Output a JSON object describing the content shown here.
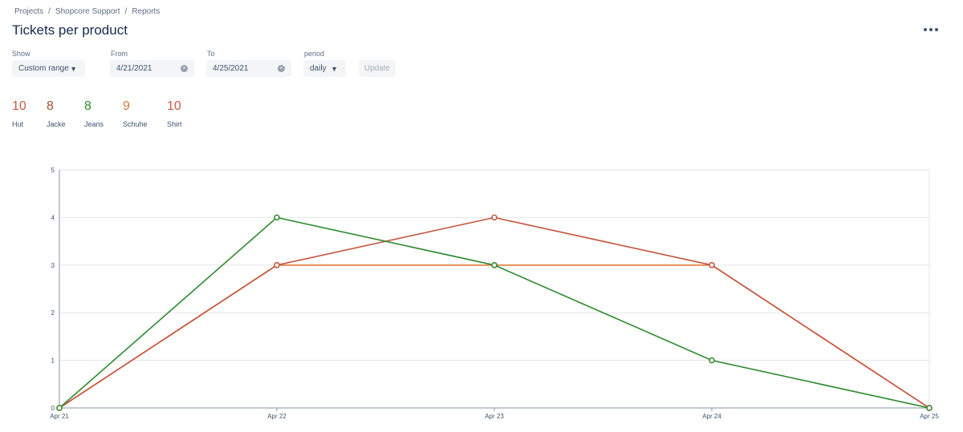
{
  "breadcrumb": {
    "items": [
      "Projects",
      "Shopcore Support",
      "Reports"
    ],
    "separator": "/"
  },
  "page": {
    "title": "Tickets per product",
    "more_icon": "more-horizontal-icon"
  },
  "filters": {
    "show": {
      "label": "Show",
      "value": "Custom range"
    },
    "from": {
      "label": "From",
      "value": "4/21/2021"
    },
    "to": {
      "label": "To",
      "value": "4/25/2021"
    },
    "period": {
      "label": "period",
      "value": "daily"
    },
    "update_label": "Update"
  },
  "summary": [
    {
      "count": "10",
      "name": "Hut",
      "color": "#c75a47"
    },
    {
      "count": "8",
      "name": "Jacke",
      "color": "#a0522d"
    },
    {
      "count": "8",
      "name": "Jeans",
      "color": "#2e8b2e"
    },
    {
      "count": "9",
      "name": "Schuhe",
      "color": "#d2793b"
    },
    {
      "count": "10",
      "name": "Shirt",
      "color": "#c75a47"
    }
  ],
  "chart_data": {
    "type": "line",
    "x": [
      "Apr 21",
      "Apr 22",
      "Apr 23",
      "Apr 24",
      "Apr 25"
    ],
    "ylim": [
      0,
      5
    ],
    "yticks": [
      0,
      1,
      2,
      3,
      4,
      5
    ],
    "grid": true,
    "series": [
      {
        "color": "#e07b39",
        "values": [
          0,
          3,
          3,
          3,
          0
        ]
      },
      {
        "color": "#c4553f",
        "values": [
          0,
          3,
          4,
          3,
          0
        ]
      },
      {
        "color": "#2f8a2f",
        "values": [
          0,
          4,
          3,
          1,
          0
        ]
      }
    ]
  }
}
